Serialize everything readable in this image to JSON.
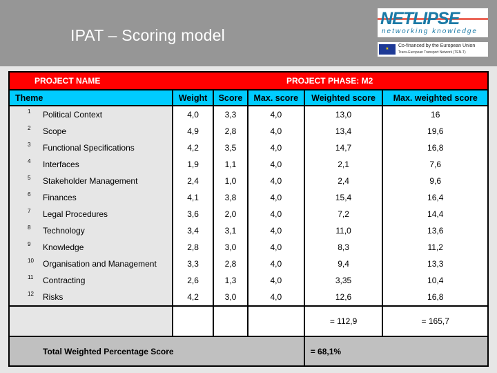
{
  "header": {
    "title": "IPAT – Scoring model",
    "logo": {
      "name": "NETLIPSE",
      "tagline": "networking knowledge",
      "eu_line1": "Co-financed by the European Union",
      "eu_line2": "Trans-European Transport Network (TEN-T)",
      "eu_flag": "★"
    }
  },
  "table": {
    "project_name_label": "PROJECT NAME",
    "project_phase_label": "PROJECT PHASE: M2",
    "columns": [
      "Theme",
      "Weight",
      "Score",
      "Max. score",
      "Weighted score",
      "Max. weighted score"
    ],
    "rows": [
      {
        "num": "1",
        "theme": "Political Context",
        "weight": "4,0",
        "score": "3,3",
        "max_score": "4,0",
        "weighted": "13,0",
        "max_weighted": "16"
      },
      {
        "num": "2",
        "theme": "Scope",
        "weight": "4,9",
        "score": "2,8",
        "max_score": "4,0",
        "weighted": "13,4",
        "max_weighted": "19,6"
      },
      {
        "num": "3",
        "theme": "Functional Specifications",
        "weight": "4,2",
        "score": "3,5",
        "max_score": "4,0",
        "weighted": "14,7",
        "max_weighted": "16,8"
      },
      {
        "num": "4",
        "theme": "Interfaces",
        "weight": "1,9",
        "score": "1,1",
        "max_score": "4,0",
        "weighted": "2,1",
        "max_weighted": "7,6"
      },
      {
        "num": "5",
        "theme": "Stakeholder Management",
        "weight": "2,4",
        "score": "1,0",
        "max_score": "4,0",
        "weighted": "2,4",
        "max_weighted": "9,6"
      },
      {
        "num": "6",
        "theme": "Finances",
        "weight": "4,1",
        "score": "3,8",
        "max_score": "4,0",
        "weighted": "15,4",
        "max_weighted": "16,4"
      },
      {
        "num": "7",
        "theme": "Legal Procedures",
        "weight": "3,6",
        "score": "2,0",
        "max_score": "4,0",
        "weighted": "7,2",
        "max_weighted": "14,4"
      },
      {
        "num": "8",
        "theme": "Technology",
        "weight": "3,4",
        "score": "3,1",
        "max_score": "4,0",
        "weighted": "11,0",
        "max_weighted": "13,6"
      },
      {
        "num": "9",
        "theme": "Knowledge",
        "weight": "2,8",
        "score": "3,0",
        "max_score": "4,0",
        "weighted": "8,3",
        "max_weighted": "11,2"
      },
      {
        "num": "10",
        "theme": "Organisation and Management",
        "weight": "3,3",
        "score": "2,8",
        "max_score": "4,0",
        "weighted": "9,4",
        "max_weighted": "13,3"
      },
      {
        "num": "11",
        "theme": "Contracting",
        "weight": "2,6",
        "score": "1,3",
        "max_score": "4,0",
        "weighted": "3,35",
        "max_weighted": "10,4"
      },
      {
        "num": "12",
        "theme": "Risks",
        "weight": "4,2",
        "score": "3,0",
        "max_score": "4,0",
        "weighted": "12,6",
        "max_weighted": "16,8"
      }
    ],
    "sum_weighted": "= 112,9",
    "sum_max_weighted": "= 165,7",
    "total_label": "Total Weighted Percentage Score",
    "total_value": "= 68,1%"
  },
  "colors": {
    "band": "#969696",
    "phase_header": "#ff0000",
    "column_header": "#00ccff",
    "total_row": "#c0c0c0"
  }
}
